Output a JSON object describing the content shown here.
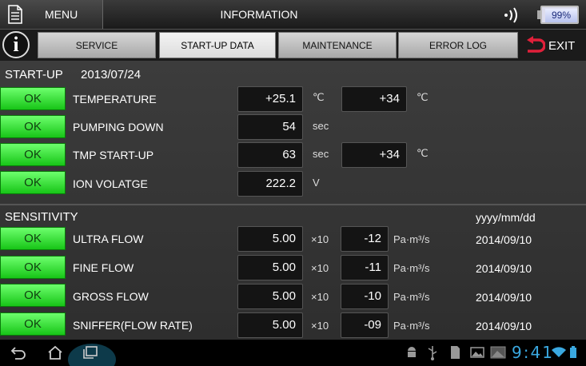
{
  "header": {
    "menu_label": "MENU",
    "title": "INFORMATION",
    "battery_pct": "99%"
  },
  "tabs": [
    {
      "label": "SERVICE",
      "active": false
    },
    {
      "label": "START-UP DATA",
      "active": true
    },
    {
      "label": "MAINTENANCE",
      "active": false
    },
    {
      "label": "ERROR LOG",
      "active": false
    }
  ],
  "exit_label": "EXIT",
  "startup": {
    "title": "START-UP",
    "date": "2013/07/24",
    "rows": [
      {
        "status": "OK",
        "label": "TEMPERATURE",
        "value": "+25.1",
        "unit": "℃",
        "value2": "+34",
        "unit2": "℃"
      },
      {
        "status": "OK",
        "label": "PUMPING DOWN",
        "value": "54",
        "unit": "sec"
      },
      {
        "status": "OK",
        "label": "TMP START-UP",
        "value": "63",
        "unit": "sec",
        "value2": "+34",
        "unit2": "℃"
      },
      {
        "status": "OK",
        "label": "ION VOLATGE",
        "value": "222.2",
        "unit": "V"
      }
    ]
  },
  "sensitivity": {
    "title": "SENSITIVITY",
    "date_format": "yyyy/mm/dd",
    "rows": [
      {
        "status": "OK",
        "label": "ULTRA FLOW",
        "mantissa": "5.00",
        "times": "×10",
        "exponent": "-12",
        "unit": "Pa·m³/s",
        "date": "2014/09/10"
      },
      {
        "status": "OK",
        "label": "FINE FLOW",
        "mantissa": "5.00",
        "times": "×10",
        "exponent": "-11",
        "unit": "Pa·m³/s",
        "date": "2014/09/10"
      },
      {
        "status": "OK",
        "label": "GROSS FLOW",
        "mantissa": "5.00",
        "times": "×10",
        "exponent": "-10",
        "unit": "Pa·m³/s",
        "date": "2014/09/10"
      },
      {
        "status": "OK",
        "label": "SNIFFER(FLOW RATE)",
        "mantissa": "5.00",
        "times": "×10",
        "exponent": "-09",
        "unit": "Pa·m³/s",
        "date": "2014/09/10"
      }
    ]
  },
  "system_bar": {
    "clock": "9:41",
    "icons": [
      "back-icon",
      "home-icon",
      "recent-apps-icon",
      "android-debug-icon",
      "usb-icon",
      "sd-card-icon",
      "image-icon",
      "screenshot-icon",
      "wifi-icon",
      "battery-icon"
    ]
  },
  "colors": {
    "ok_green": "#2ee82e",
    "clock_blue": "#3aa8e0",
    "exit_red": "#e0203a"
  }
}
